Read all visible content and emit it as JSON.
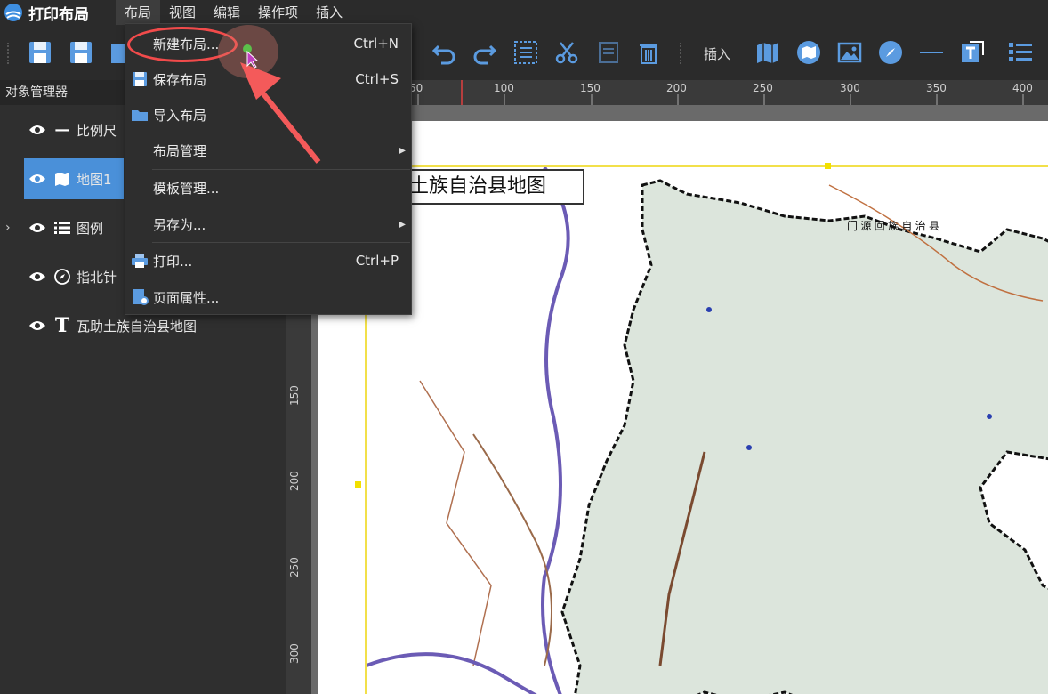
{
  "app": {
    "title": "打印布局"
  },
  "menubar": {
    "items": [
      "布局",
      "视图",
      "编辑",
      "操作项",
      "插入"
    ]
  },
  "toolbar": {
    "insert_label": "插入"
  },
  "object_manager": {
    "header": "对象管理器",
    "items": [
      {
        "label": "比例尺",
        "icon": "scale-bar-icon"
      },
      {
        "label": "地图1",
        "icon": "map-icon",
        "selected": true
      },
      {
        "label": "图例",
        "icon": "legend-icon",
        "expandable": true
      },
      {
        "label": "指北针",
        "icon": "compass-icon"
      },
      {
        "label": "瓦助土族自治县地图",
        "icon": "text-icon"
      }
    ]
  },
  "ruler": {
    "top": [
      "50",
      "100",
      "150",
      "200",
      "250",
      "300",
      "350",
      "400"
    ],
    "left": [
      "150",
      "200",
      "250",
      "300"
    ]
  },
  "layout_menu": {
    "items": [
      {
        "label": "新建布局...",
        "shortcut": "Ctrl+N",
        "icon": "new-layout-icon"
      },
      {
        "label": "保存布局",
        "shortcut": "Ctrl+S",
        "icon": "save-icon"
      },
      {
        "label": "导入布局",
        "shortcut": "",
        "icon": "folder-icon"
      },
      {
        "label": "布局管理",
        "shortcut": "",
        "submenu": true
      },
      {
        "label": "模板管理...",
        "shortcut": ""
      },
      {
        "label": "另存为...",
        "shortcut": "",
        "submenu": true
      },
      {
        "label": "打印...",
        "shortcut": "Ctrl+P",
        "icon": "print-icon"
      },
      {
        "label": "页面属性...",
        "shortcut": "",
        "icon": "page-settings-icon"
      }
    ]
  },
  "map": {
    "title_box": "土族自治县地图",
    "region_label": "门 源 回 族 自 治 县"
  },
  "colors": {
    "accent": "#4a90d9",
    "highlight": "#f24b4b",
    "map_fill": "#dce5dc",
    "frame": "#f2e04a"
  }
}
